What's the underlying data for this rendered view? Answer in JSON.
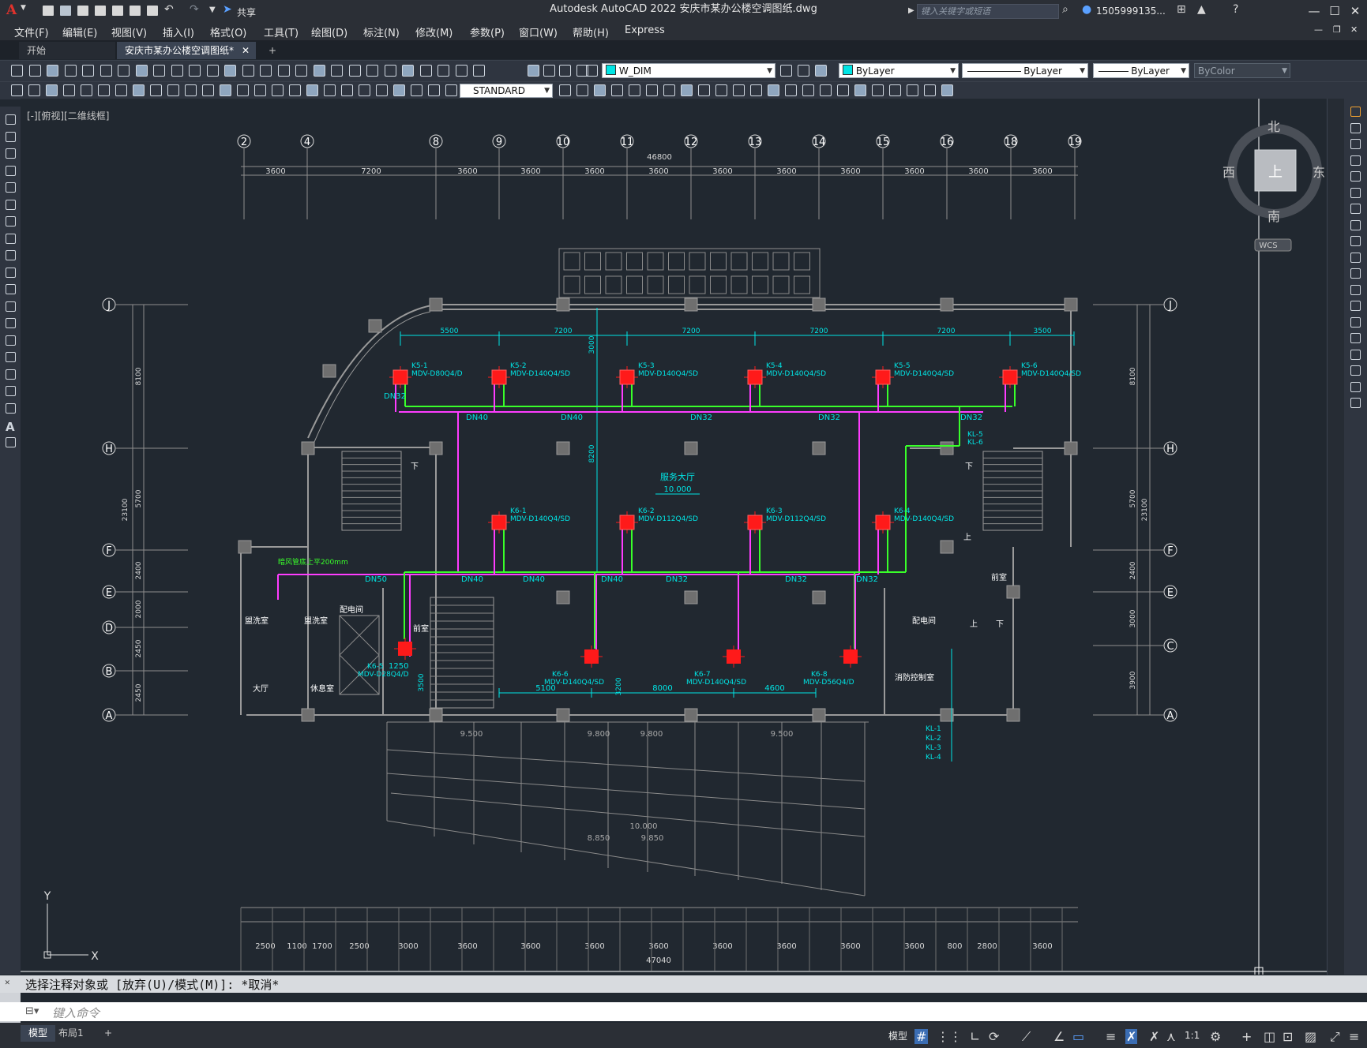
{
  "window": {
    "title": "Autodesk AutoCAD 2022    安庆市某办公楼空调图纸.dwg",
    "app_logo": "A",
    "share_label": "共享",
    "search_placeholder": "键入关键字或短语",
    "user": "1505999135...",
    "controls": [
      "—",
      "☐",
      "✕"
    ]
  },
  "menu": [
    "文件(F)",
    "编辑(E)",
    "视图(V)",
    "插入(I)",
    "格式(O)",
    "工具(T)",
    "绘图(D)",
    "标注(N)",
    "修改(M)",
    "参数(P)",
    "窗口(W)",
    "帮助(H)",
    "Express"
  ],
  "tabs": {
    "start": "开始",
    "active": "安庆市某办公楼空调图纸*",
    "add": "+"
  },
  "toolbar": {
    "layer": "W_DIM",
    "layer_color": "#00e5e5",
    "color": "ByLayer",
    "linetype": "ByLayer",
    "lineweight": "ByLayer",
    "plotstyle": "ByColor",
    "text_style": "STANDARD"
  },
  "viewport": {
    "label": "[-][俯视][二维线框]"
  },
  "viewcube": {
    "north": "北",
    "south": "南",
    "east": "东",
    "west": "西",
    "top": "上",
    "wcs": "WCS"
  },
  "drawing": {
    "col_axes": [
      "2",
      "4",
      "8",
      "9",
      "10",
      "11",
      "12",
      "13",
      "14",
      "15",
      "16",
      "18",
      "19"
    ],
    "row_axes_left": [
      "J",
      "H",
      "F",
      "E",
      "D",
      "B",
      "A"
    ],
    "row_axes_right": [
      "J",
      "H",
      "F",
      "E",
      "C",
      "A"
    ],
    "top_total": "46800",
    "top_dims": [
      "3600",
      "7200",
      "3600",
      "3600",
      "3600",
      "3600",
      "3600",
      "3600",
      "3600",
      "3600",
      "3600",
      "3600",
      "3600"
    ],
    "bottom_total": "47040",
    "bottom_dims": [
      "2500",
      "1100",
      "1700",
      "2500",
      "3000",
      "3600",
      "3600",
      "3600",
      "3600",
      "3600",
      "3600",
      "3600",
      "3600",
      "800",
      "2800",
      "3600"
    ],
    "pipe_dims_top": [
      "5500",
      "7200",
      "7200",
      "7200",
      "7200",
      "3500"
    ],
    "left_dims": [
      "8100",
      "5700",
      "2400",
      "2000",
      "2450",
      "2450"
    ],
    "left_total": "23100",
    "right_dims": [
      "8100",
      "5700",
      "2400",
      "3000",
      "3900"
    ],
    "right_total": "23100",
    "units_top": [
      {
        "tag": "K5-1",
        "model": "MDV-D80Q4/D"
      },
      {
        "tag": "K5-2",
        "model": "MDV-D140Q4/SD"
      },
      {
        "tag": "K5-3",
        "model": "MDV-D140Q4/SD"
      },
      {
        "tag": "K5-4",
        "model": "MDV-D140Q4/SD"
      },
      {
        "tag": "K5-5",
        "model": "MDV-D140Q4/SD"
      },
      {
        "tag": "K5-6",
        "model": "MDV-D140Q4/SD"
      }
    ],
    "units_mid": [
      {
        "tag": "K6-1",
        "model": "MDV-D140Q4/SD"
      },
      {
        "tag": "K6-2",
        "model": "MDV-D112Q4/SD"
      },
      {
        "tag": "K6-3",
        "model": "MDV-D112Q4/SD"
      },
      {
        "tag": "K6-4",
        "model": "MDV-D140Q4/SD"
      }
    ],
    "units_low": [
      {
        "tag": "K6-5",
        "model": "MDV-D28Q4/D"
      },
      {
        "tag": "K6-6",
        "model": "MDV-D140Q4/SD"
      },
      {
        "tag": "K6-7",
        "model": "MDV-D140Q4/SD"
      },
      {
        "tag": "K6-8",
        "model": "MDV-D56Q4/D"
      }
    ],
    "pipe_labels_top": [
      "DN32",
      "DN40",
      "DN40",
      "DN32",
      "DN32",
      "DN32"
    ],
    "pipe_labels_mid": [
      "DN50",
      "DN40",
      "DN40",
      "DN40",
      "DN32",
      "DN32",
      "DN32"
    ],
    "riser_labels": [
      "KL-5",
      "KL-6"
    ],
    "kl_labels": [
      "KL-1",
      "KL-2",
      "KL-3",
      "KL-4"
    ],
    "hall_label": "服务大厅",
    "hall_level": "10.000",
    "room_labels": [
      "盥洗室",
      "盥洗室",
      "配电间",
      "前室",
      "大厅",
      "休息室",
      "配电间",
      "前室",
      "消防控制室"
    ],
    "low_dims": [
      "5100",
      "8000",
      "4600"
    ],
    "misc_dims": [
      "1250",
      "3500",
      "3200",
      "8200",
      "3000"
    ],
    "pipe_note": "暗风管底上平200mm",
    "bottom_levels": [
      "9.500",
      "9.800",
      "9.800",
      "9.500",
      "10.000",
      "8.850",
      "9.850"
    ],
    "stair_marks": [
      "下",
      "下",
      "上",
      "上",
      "下"
    ]
  },
  "command": {
    "history": "选择注释对象或 [放弃(U)/模式(M)]: *取消*",
    "placeholder": "键入命令"
  },
  "status": {
    "model": "模型",
    "layout": "布局1",
    "add": "+",
    "mode": "模型",
    "scale": "1:1"
  }
}
